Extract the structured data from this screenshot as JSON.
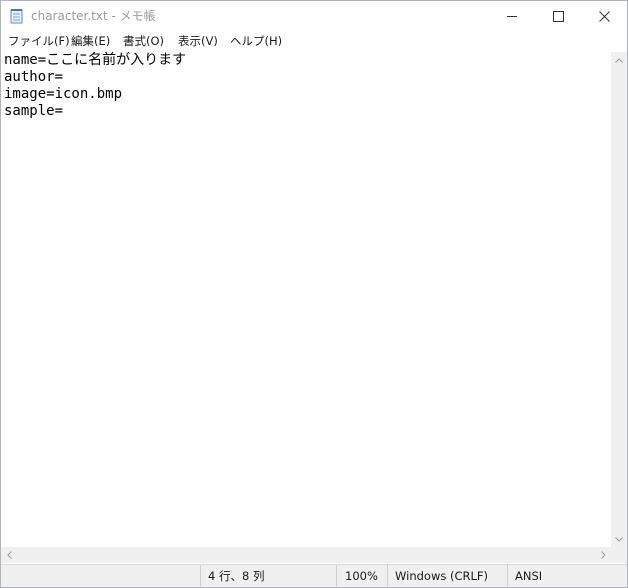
{
  "window": {
    "title": "character.txt - メモ帳"
  },
  "menu": {
    "items": [
      {
        "label": "ファイル(F)"
      },
      {
        "label": "編集(E)"
      },
      {
        "label": "書式(O)"
      },
      {
        "label": "表示(V)"
      },
      {
        "label": "ヘルプ(H)"
      }
    ]
  },
  "editor": {
    "lines": [
      "name=ここに名前が入ります",
      "author=",
      "image=icon.bmp",
      "sample="
    ]
  },
  "status": {
    "position": "4 行、8 列",
    "zoom": "100%",
    "line_ending": "Windows (CRLF)",
    "encoding": "ANSI"
  },
  "icons": {
    "app": "notepad-icon",
    "minimize": "minimize-icon",
    "maximize": "maximize-icon",
    "close": "close-icon",
    "scroll_up": "scroll-up-arrow-icon",
    "scroll_down": "scroll-down-arrow-icon",
    "scroll_left": "scroll-left-arrow-icon",
    "scroll_right": "scroll-right-arrow-icon"
  },
  "colors": {
    "title_text": "#9a9a9a",
    "statusbar_bg": "#f0f0f0",
    "text": "#000000"
  }
}
